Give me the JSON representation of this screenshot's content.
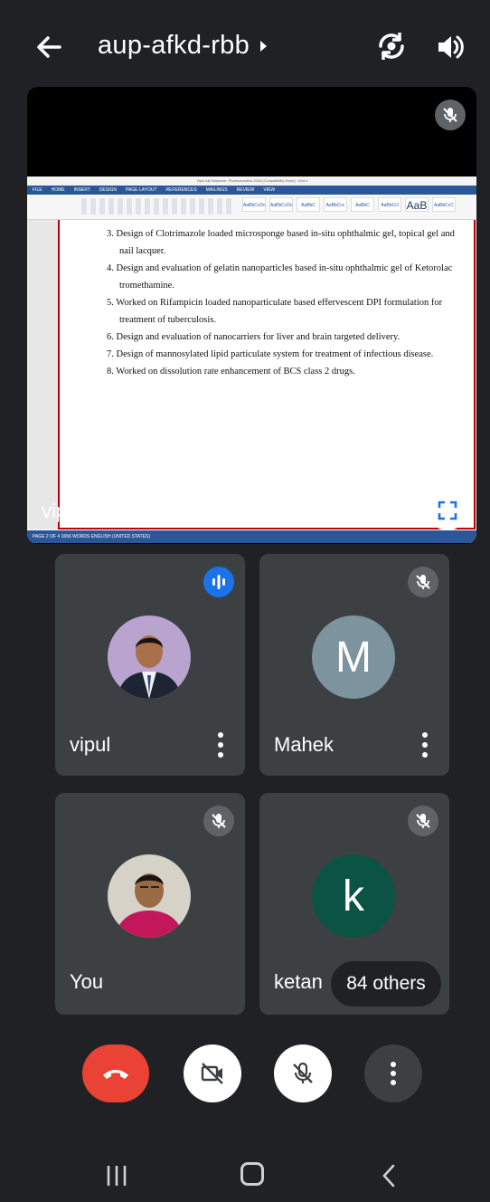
{
  "header": {
    "meeting_code": "aup-afkd-rbb",
    "icons": [
      "back-arrow-icon",
      "switch-camera-icon",
      "speaker-icon"
    ]
  },
  "presentation": {
    "presenter_text": "vipul is presenting",
    "document": {
      "window_title": "Vipul Ajit Sawsane- Pharmaceutics-2018 [Compatibility Mode] - Word",
      "tabs": [
        "FILE",
        "HOME",
        "INSERT",
        "DESIGN",
        "PAGE LAYOUT",
        "REFERENCES",
        "MAILINGS",
        "REVIEW",
        "VIEW"
      ],
      "styles": [
        "AaBbCcDc",
        "AaBbCcDc",
        "AaBbC",
        "AaBbCcc",
        "AaBbC",
        "AaBbCcl",
        "AaB",
        "AaBbCcC"
      ],
      "items": [
        "3. Design of Clotrimazole loaded microsponge based in-situ ophthalmic gel, topical gel and nail lacquer.",
        "4. Design and evaluation of gelatin nanoparticles based in-situ ophthalmic gel of Ketorolac tromethamine.",
        "5. Worked on Rifampicin loaded nanoparticulate based effervescent DPI formulation for treatment of tuberculosis.",
        "6. Design and evaluation of nanocarriers for liver and brain targeted delivery.",
        "7. Design of mannosylated lipid particulate system for treatment of infectious disease.",
        "8. Worked on dissolution rate enhancement of BCS class 2 drugs."
      ],
      "status": "PAGE 2 OF 4    1656 WORDS    ENGLISH (UNITED STATES)"
    }
  },
  "participants": [
    {
      "name": "vipul",
      "avatar": "photo",
      "status": "speaking"
    },
    {
      "name": "Mahek",
      "avatar": "M",
      "avatar_color": "#7d939d",
      "status": "muted"
    },
    {
      "name": "You",
      "avatar": "photo",
      "status": "muted"
    },
    {
      "name": "ketan",
      "avatar": "k",
      "avatar_color": "#0b5345",
      "status": "muted"
    }
  ],
  "others_label": "84 others",
  "controls": [
    "end-call",
    "camera-off",
    "mic-off",
    "more-options"
  ],
  "colors": {
    "background": "#202124",
    "tile": "#3c4043",
    "end_call": "#ea4335",
    "speaking": "#1a73e8"
  }
}
